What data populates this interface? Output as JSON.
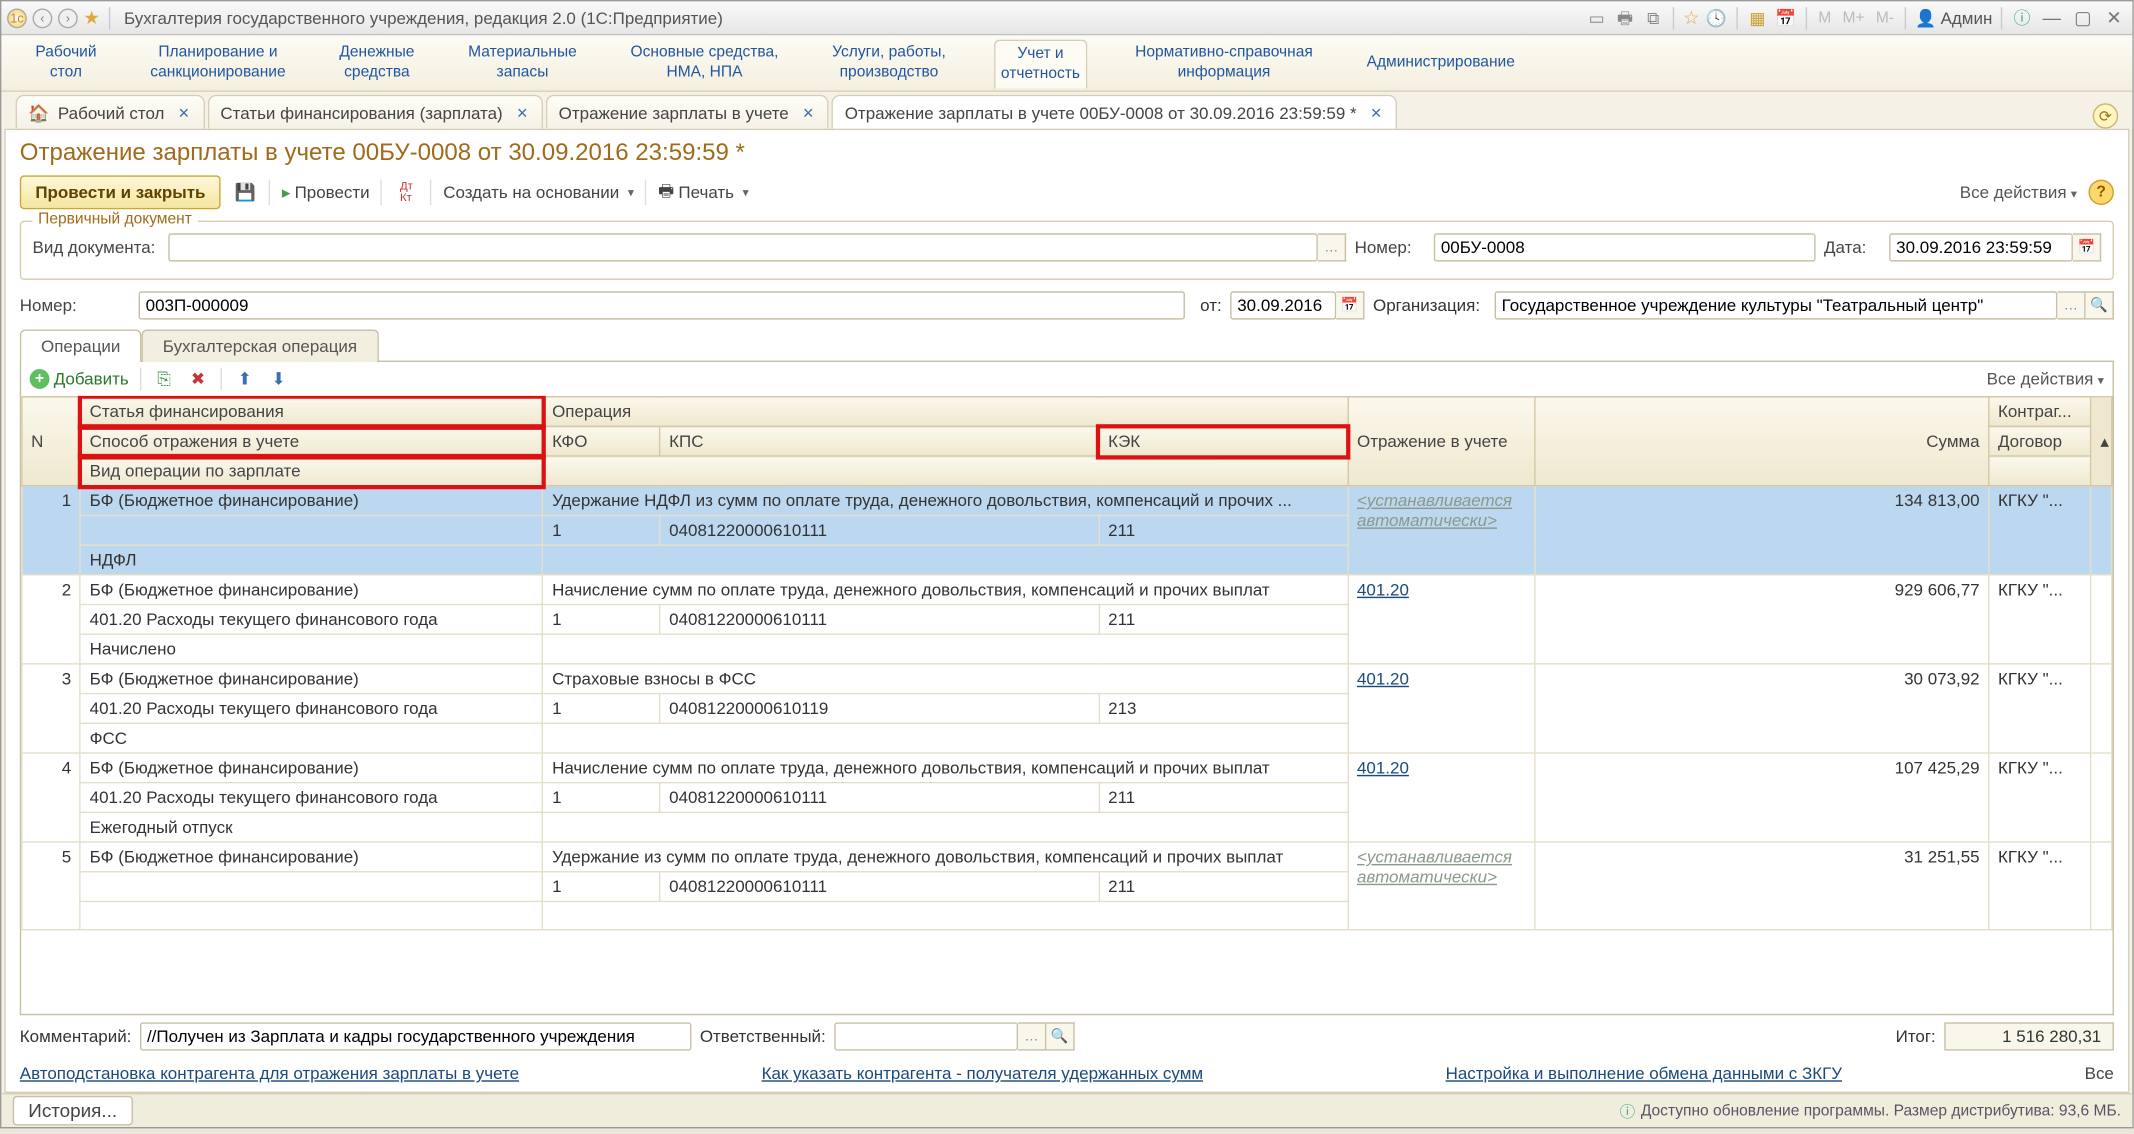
{
  "titlebar": {
    "app_title": "Бухгалтерия государственного учреждения, редакция 2.0  (1С:Предприятие)",
    "m1": "M",
    "m2": "M+",
    "m3": "M-",
    "admin": "Админ"
  },
  "sections": [
    "Рабочий\nстол",
    "Планирование и\nсанкционирование",
    "Денежные\nсредства",
    "Материальные\nзапасы",
    "Основные средства,\nНМА, НПА",
    "Услуги, работы,\nпроизводство",
    "Учет и\nотчетность",
    "Нормативно-справочная\nинформация",
    "Администрирование"
  ],
  "tabs": [
    "Рабочий стол",
    "Статьи финансирования (зарплата)",
    "Отражение зарплаты в учете",
    "Отражение зарплаты в учете 00БУ-0008 от 30.09.2016 23:59:59 *"
  ],
  "doc": {
    "title": "Отражение зарплаты в учете 00БУ-0008 от 30.09.2016 23:59:59 *",
    "post_close": "Провести и закрыть",
    "post": "Провести",
    "create_based": "Создать на основании",
    "print": "Печать",
    "all_actions": "Все действия",
    "groupbox_title": "Первичный документ",
    "vid_doc_lbl": "Вид документа:",
    "number_lbl": "Номер:",
    "number_val": "00БУ-0008",
    "date_lbl": "Дата:",
    "date_val": "30.09.2016 23:59:59",
    "inner_number_lbl": "Номер:",
    "inner_number_val": "003П-000009",
    "ot_lbl": "от:",
    "ot_val": "30.09.2016",
    "org_lbl": "Организация:",
    "org_val": "Государственное учреждение культуры \"Театральный центр\"",
    "tab_ops": "Операции",
    "tab_acc": "Бухгалтерская операция",
    "add": "Добавить",
    "all_actions2": "Все действия"
  },
  "table": {
    "headers": {
      "n": "N",
      "fin": "Статья финансирования",
      "refl_m": "Способ отражения в учете",
      "op_type": "Вид операции по зарплате",
      "op": "Операция",
      "kfo": "КФО",
      "kps": "КПС",
      "kek": "КЭК",
      "refl": "Отражение в учете",
      "sum": "Сумма",
      "ctr": "Контраг...",
      "dog": "Договор"
    },
    "rows": [
      {
        "n": "1",
        "fin": "БФ (Бюджетное финансирование)",
        "refl_m": "",
        "op_type": "НДФЛ",
        "op": "Удержание НДФЛ из сумм по оплате труда, денежного довольствия, компенсаций и прочих ...",
        "kfo": "1",
        "kps": "04081220000610111",
        "kek": "211",
        "refl": "<устанавливается автоматически>",
        "refl_gray": true,
        "sum": "134 813,00",
        "ctr": "КГКУ \"..."
      },
      {
        "n": "2",
        "fin": "БФ (Бюджетное финансирование)",
        "refl_m": "401.20 Расходы текущего финансового года",
        "op_type": "Начислено",
        "op": "Начисление сумм по оплате труда, денежного довольствия, компенсаций и прочих выплат",
        "kfo": "1",
        "kps": "04081220000610111",
        "kek": "211",
        "refl": "401.20",
        "sum": "929 606,77",
        "ctr": "КГКУ \"..."
      },
      {
        "n": "3",
        "fin": "БФ (Бюджетное финансирование)",
        "refl_m": "401.20 Расходы текущего финансового года",
        "op_type": "ФСС",
        "op": "Страховые взносы в ФСС",
        "kfo": "1",
        "kps": "04081220000610119",
        "kek": "213",
        "refl": "401.20",
        "sum": "30 073,92",
        "ctr": "КГКУ \"..."
      },
      {
        "n": "4",
        "fin": "БФ (Бюджетное финансирование)",
        "refl_m": "401.20 Расходы текущего финансового года",
        "op_type": "Ежегодный отпуск",
        "op": "Начисление сумм по оплате труда, денежного довольствия, компенсаций и прочих выплат",
        "kfo": "1",
        "kps": "04081220000610111",
        "kek": "211",
        "refl": "401.20",
        "sum": "107 425,29",
        "ctr": "КГКУ \"..."
      },
      {
        "n": "5",
        "fin": "БФ (Бюджетное финансирование)",
        "refl_m": "",
        "op_type": "",
        "op": "Удержание из сумм по оплате труда, денежного довольствия, компенсаций и прочих выплат",
        "kfo": "1",
        "kps": "04081220000610111",
        "kek": "211",
        "refl": "<устанавливается автоматически>",
        "refl_gray": true,
        "sum": "31 251,55",
        "ctr": "КГКУ \"..."
      }
    ]
  },
  "footer": {
    "comment_lbl": "Комментарий:",
    "comment_val": "//Получен из Зарплата и кадры государственного учреждения",
    "resp_lbl": "Ответственный:",
    "itog_lbl": "Итог:",
    "itog_val": "1 516 280,31",
    "link1": "Автоподстановка контрагента для отражения зарплаты в учете",
    "link2": "Как указать контрагента - получателя удержанных сумм",
    "link3": "Настройка и выполнение обмена данными с ЗКГУ",
    "link_all": "Все"
  },
  "statusbar": {
    "history": "История...",
    "info": "Доступно обновление программы. Размер дистрибутива: 93,6 МБ."
  }
}
